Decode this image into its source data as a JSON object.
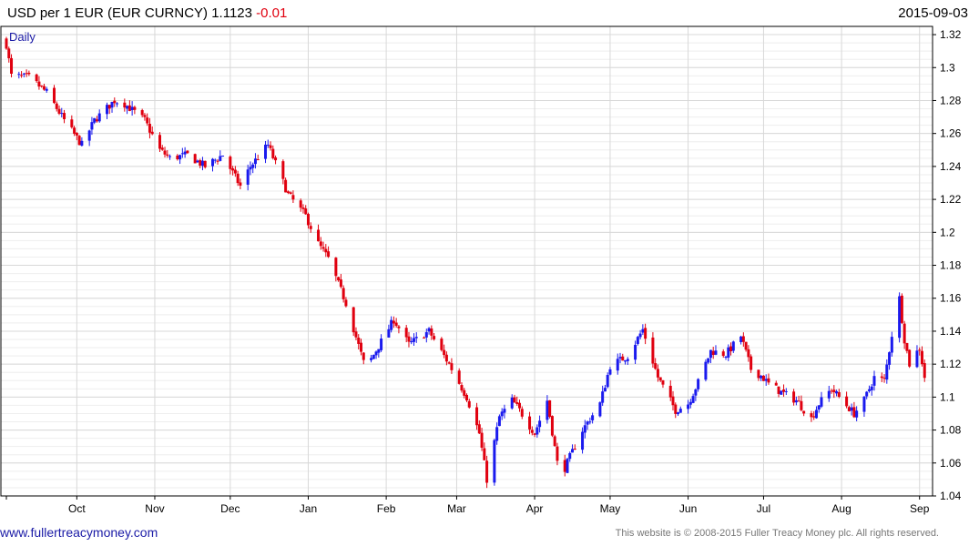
{
  "header": {
    "symbol_label": "USD per 1 EUR (EUR CURNCY)",
    "last": "1.1123",
    "change": "-0.01",
    "date": "2015-09-03"
  },
  "footer": {
    "site": "www.fullertreacymoney.com",
    "copyright": "This website is © 2008-2015 Fuller Treacy Money plc. All rights reserved."
  },
  "colors": {
    "up": "#1a1aee",
    "down": "#e0000f",
    "grid": "#d8d8d8",
    "frame": "#000000"
  },
  "chart_data": {
    "type": "candlestick",
    "period_label": "Daily",
    "ylim": [
      1.04,
      1.325
    ],
    "y_ticks": [
      1.04,
      1.06,
      1.08,
      1.1,
      1.12,
      1.14,
      1.16,
      1.18,
      1.2,
      1.22,
      1.24,
      1.26,
      1.28,
      1.3,
      1.32
    ],
    "y_tick_labels": [
      "1.04",
      "1.06",
      "1.08",
      "1.1",
      "1.12",
      "1.14",
      "1.16",
      "1.18",
      "1.2",
      "1.22",
      "1.24",
      "1.26",
      "1.28",
      "1.3",
      "1.32"
    ],
    "x_range": [
      "2014-09-03",
      "2015-09-04"
    ],
    "month_labels": [
      {
        "label": "Oct",
        "date": "2014-10-01"
      },
      {
        "label": "Nov",
        "date": "2014-11-01"
      },
      {
        "label": "Dec",
        "date": "2014-12-01"
      },
      {
        "label": "Jan",
        "date": "2015-01-01"
      },
      {
        "label": "Feb",
        "date": "2015-02-01"
      },
      {
        "label": "Mar",
        "date": "2015-03-01"
      },
      {
        "label": "Apr",
        "date": "2015-04-01"
      },
      {
        "label": "May",
        "date": "2015-05-01"
      },
      {
        "label": "Jun",
        "date": "2015-06-01"
      },
      {
        "label": "Jul",
        "date": "2015-07-01"
      },
      {
        "label": "Aug",
        "date": "2015-08-01"
      },
      {
        "label": "Sep",
        "date": "2015-09-01"
      }
    ],
    "close_path": [
      [
        "2014-09-03",
        1.314
      ],
      [
        "2014-09-05",
        1.295
      ],
      [
        "2014-09-12",
        1.294
      ],
      [
        "2014-09-19",
        1.285
      ],
      [
        "2014-09-26",
        1.268
      ],
      [
        "2014-10-03",
        1.253
      ],
      [
        "2014-10-08",
        1.268
      ],
      [
        "2014-10-16",
        1.28
      ],
      [
        "2014-10-20",
        1.278
      ],
      [
        "2014-10-28",
        1.268
      ],
      [
        "2014-11-03",
        1.25
      ],
      [
        "2014-11-07",
        1.245
      ],
      [
        "2014-11-14",
        1.247
      ],
      [
        "2014-11-21",
        1.24
      ],
      [
        "2014-11-28",
        1.247
      ],
      [
        "2014-12-05",
        1.228
      ],
      [
        "2014-12-09",
        1.24
      ],
      [
        "2014-12-16",
        1.253
      ],
      [
        "2014-12-24",
        1.223
      ],
      [
        "2014-12-31",
        1.21
      ],
      [
        "2015-01-05",
        1.193
      ],
      [
        "2015-01-09",
        1.184
      ],
      [
        "2015-01-16",
        1.157
      ],
      [
        "2015-01-23",
        1.121
      ],
      [
        "2015-01-26",
        1.123
      ],
      [
        "2015-02-04",
        1.147
      ],
      [
        "2015-02-10",
        1.132
      ],
      [
        "2015-02-18",
        1.14
      ],
      [
        "2015-02-26",
        1.12
      ],
      [
        "2015-03-05",
        1.1
      ],
      [
        "2015-03-10",
        1.078
      ],
      [
        "2015-03-13",
        1.05
      ],
      [
        "2015-03-18",
        1.088
      ],
      [
        "2015-03-23",
        1.098
      ],
      [
        "2015-03-26",
        1.092
      ],
      [
        "2015-04-01",
        1.078
      ],
      [
        "2015-04-06",
        1.098
      ],
      [
        "2015-04-10",
        1.06
      ],
      [
        "2015-04-13",
        1.057
      ],
      [
        "2015-04-20",
        1.08
      ],
      [
        "2015-04-27",
        1.096
      ],
      [
        "2015-05-01",
        1.119
      ],
      [
        "2015-05-08",
        1.125
      ],
      [
        "2015-05-14",
        1.141
      ],
      [
        "2015-05-20",
        1.112
      ],
      [
        "2015-05-27",
        1.092
      ],
      [
        "2015-06-01",
        1.096
      ],
      [
        "2015-06-05",
        1.109
      ],
      [
        "2015-06-10",
        1.128
      ],
      [
        "2015-06-16",
        1.126
      ],
      [
        "2015-06-22",
        1.137
      ],
      [
        "2015-06-26",
        1.117
      ],
      [
        "2015-06-30",
        1.113
      ],
      [
        "2015-07-03",
        1.108
      ],
      [
        "2015-07-08",
        1.103
      ],
      [
        "2015-07-14",
        1.098
      ],
      [
        "2015-07-20",
        1.087
      ],
      [
        "2015-07-23",
        1.096
      ],
      [
        "2015-07-28",
        1.105
      ],
      [
        "2015-08-03",
        1.095
      ],
      [
        "2015-08-06",
        1.09
      ],
      [
        "2015-08-10",
        1.098
      ],
      [
        "2015-08-14",
        1.112
      ],
      [
        "2015-08-18",
        1.11
      ],
      [
        "2015-08-21",
        1.138
      ],
      [
        "2015-08-24",
        1.16
      ],
      [
        "2015-08-26",
        1.135
      ],
      [
        "2015-08-28",
        1.12
      ],
      [
        "2015-09-01",
        1.13
      ],
      [
        "2015-09-03",
        1.1123
      ]
    ]
  }
}
